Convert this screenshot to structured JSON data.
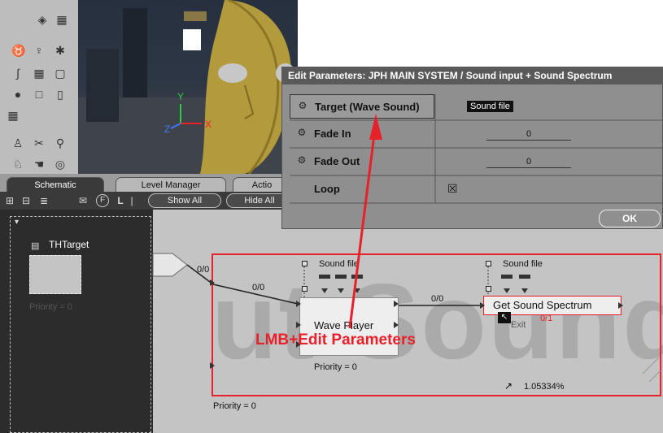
{
  "tabs": [
    {
      "label": "Schematic",
      "active": true
    },
    {
      "label": "Level Manager",
      "active": false
    },
    {
      "label": "Actio",
      "active": false
    }
  ],
  "toolbar": {
    "show_all_label": "Show All",
    "hide_all_label": "Hide All",
    "level_label": "L"
  },
  "left_panel": {
    "object_name": "THTarget",
    "priority": "Priority = 0"
  },
  "viewport": {
    "axis_y": "Y",
    "axis_x": "X",
    "axis_z": "Z"
  },
  "dialog": {
    "title": "Edit Parameters: JPH MAIN SYSTEM / Sound input + Sound Spectrum",
    "params": [
      {
        "name": "Target (Wave Sound)",
        "value": "Sound file"
      },
      {
        "name": "Fade In",
        "value": "0"
      },
      {
        "name": "Fade Out",
        "value": "0"
      },
      {
        "name": "Loop",
        "value": "☒"
      }
    ],
    "ok_label": "OK"
  },
  "schematic": {
    "watermark": "ut Sound",
    "link_label_1": "0/0",
    "link_label_2": "0/0",
    "link_label_3": "0/0",
    "link_label_4": "0/1",
    "wave_player": {
      "label": "Wave Player",
      "param_label": "Sound file",
      "priority": "Priority = 0"
    },
    "spectrum": {
      "label": "Get Sound Spectrum",
      "param_label": "Sound file",
      "exit_label": "Exit"
    },
    "percent_label": "1.05334%",
    "outer_priority": "Priority = 0"
  },
  "annotation": {
    "text": "LMB+Edit Parameters"
  },
  "colors": {
    "annotation_red": "#e8202a",
    "dialog_bg": "#8f8f8f",
    "dark_panel": "#2c2c2c"
  }
}
